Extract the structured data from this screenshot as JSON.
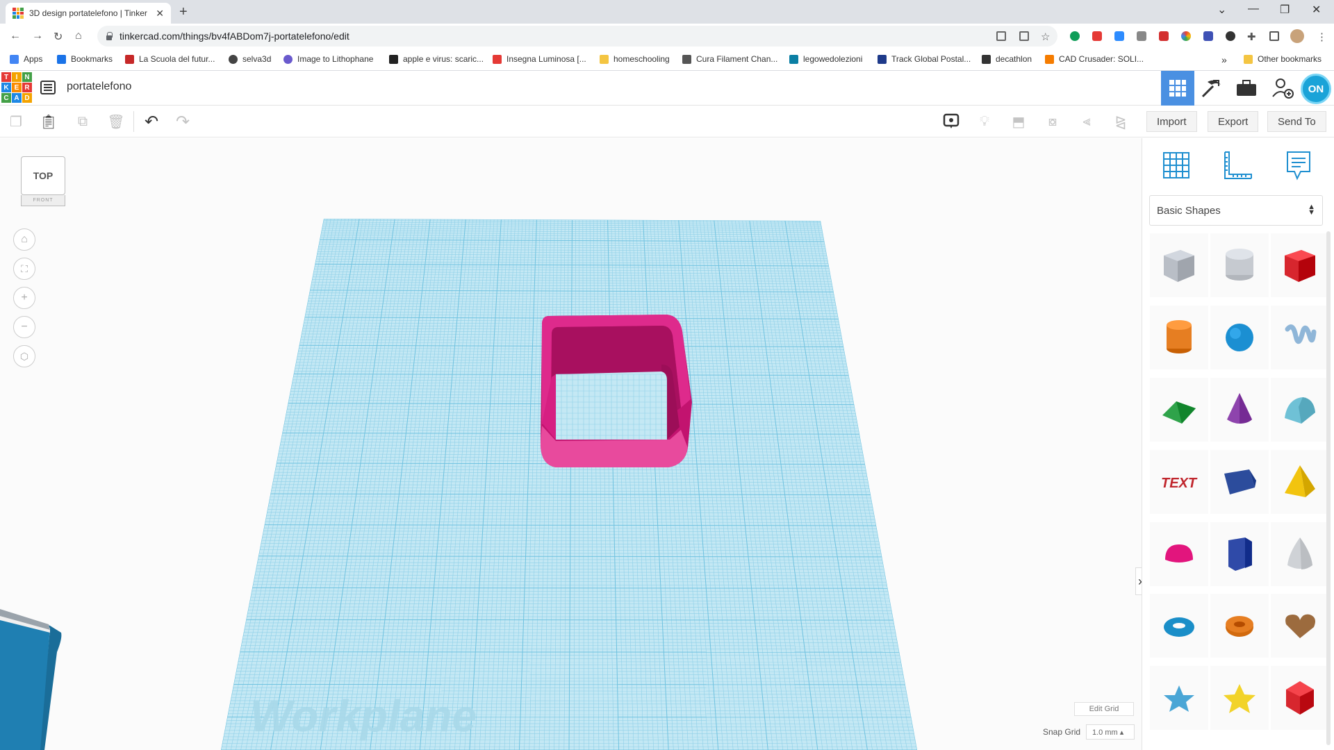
{
  "browser": {
    "tab_title": "3D design portatelefono | Tinker",
    "url": "tinkercad.com/things/bv4fABDom7j-portatelefono/edit",
    "bookmarks": [
      {
        "label": "Apps",
        "color": "#4285f4"
      },
      {
        "label": "Bookmarks",
        "color": "#1a73e8"
      },
      {
        "label": "La Scuola del futur...",
        "color": "#c62828"
      },
      {
        "label": "selva3d",
        "color": "#444444"
      },
      {
        "label": "Image to Lithophane",
        "color": "#6a5acd"
      },
      {
        "label": "apple e virus: scaric...",
        "color": "#222222"
      },
      {
        "label": "Insegna Luminosa [...",
        "color": "#e53935"
      },
      {
        "label": "homeschooling",
        "color": "#f4c542"
      },
      {
        "label": "Cura Filament Chan...",
        "color": "#555555"
      },
      {
        "label": "legowedolezioni",
        "color": "#0b7fa4"
      },
      {
        "label": "Track Global Postal...",
        "color": "#1e3a8a"
      },
      {
        "label": "decathlon",
        "color": "#333333"
      },
      {
        "label": "CAD Crusader: SOLI...",
        "color": "#f57c00"
      }
    ],
    "more": "»",
    "other_bookmarks": "Other bookmarks"
  },
  "app": {
    "logo_letters": [
      "T",
      "I",
      "N",
      "K",
      "E",
      "R",
      "C",
      "A",
      "D"
    ],
    "design_name": "portatelefono",
    "user_initials": "ON"
  },
  "toolbar": {
    "import": "Import",
    "export": "Export",
    "send_to": "Send To"
  },
  "viewcube": {
    "top": "TOP",
    "front": "FRONT"
  },
  "workplane": {
    "label": "Workplane",
    "edit_grid": "Edit Grid",
    "snap_grid_label": "Snap Grid",
    "snap_grid_value": "1.0 mm ▴"
  },
  "panel": {
    "category": "Basic Shapes",
    "shapes": [
      {
        "name": "box-hole",
        "color": "#b9bec6"
      },
      {
        "name": "cylinder-hole",
        "color": "#c6cad0"
      },
      {
        "name": "box",
        "color": "#d7262e"
      },
      {
        "name": "cylinder",
        "color": "#e67e22"
      },
      {
        "name": "sphere",
        "color": "#1b8fd2"
      },
      {
        "name": "scribble",
        "color": "#8fb6d8"
      },
      {
        "name": "roof",
        "color": "#2fa34a"
      },
      {
        "name": "cone",
        "color": "#8e44ad"
      },
      {
        "name": "round-roof",
        "color": "#6fc1d6"
      },
      {
        "name": "text",
        "color": "#c0262d"
      },
      {
        "name": "wedge",
        "color": "#2c4c9c"
      },
      {
        "name": "pyramid",
        "color": "#f2c40f"
      },
      {
        "name": "half-sphere",
        "color": "#e2157d"
      },
      {
        "name": "polygon",
        "color": "#2f4aa8"
      },
      {
        "name": "paraboloid",
        "color": "#cfd2d6"
      },
      {
        "name": "torus",
        "color": "#1a8ec8"
      },
      {
        "name": "tube",
        "color": "#e67e22"
      },
      {
        "name": "heart",
        "color": "#9c6b3e"
      },
      {
        "name": "star",
        "color": "#4aa6d6"
      },
      {
        "name": "star-yellow",
        "color": "#f2d32a"
      },
      {
        "name": "icosahedron",
        "color": "#d7262e"
      }
    ]
  },
  "colors": {
    "accent": "#4a90e2",
    "workplane": "#bfe6f2",
    "grid_line": "#8fd0e8",
    "object": "#d6177e"
  }
}
